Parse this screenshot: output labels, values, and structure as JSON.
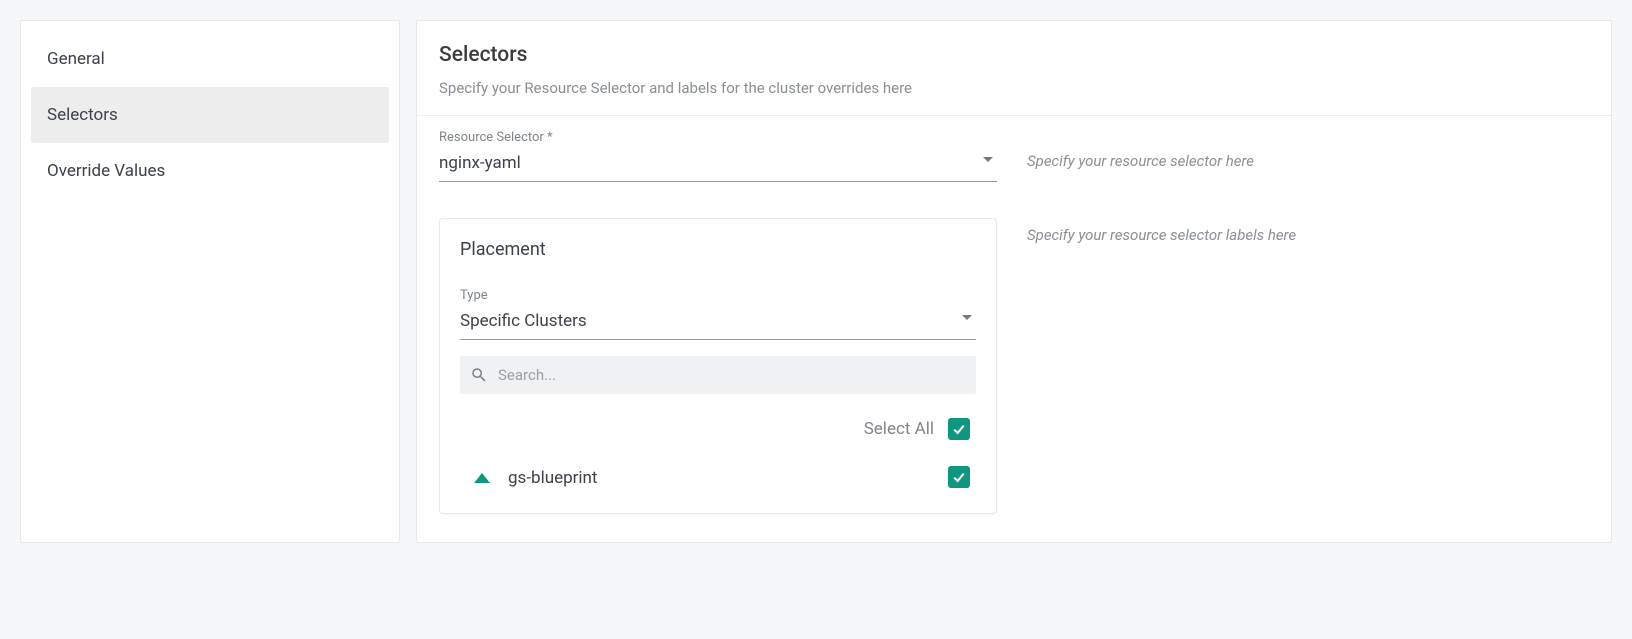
{
  "sidebar": {
    "items": [
      {
        "label": "General",
        "active": false
      },
      {
        "label": "Selectors",
        "active": true
      },
      {
        "label": "Override Values",
        "active": false
      }
    ]
  },
  "header": {
    "title": "Selectors",
    "subtitle": "Specify your Resource Selector and labels for the cluster overrides here"
  },
  "resourceSelector": {
    "label": "Resource Selector *",
    "value": "nginx-yaml",
    "helper": "Specify your resource selector here"
  },
  "placement": {
    "title": "Placement",
    "typeLabel": "Type",
    "typeValue": "Specific Clusters",
    "searchPlaceholder": "Search...",
    "selectAllLabel": "Select All",
    "selectAllChecked": true,
    "helper": "Specify your resource selector labels here",
    "clusters": [
      {
        "name": "gs-blueprint",
        "checked": true
      }
    ]
  }
}
